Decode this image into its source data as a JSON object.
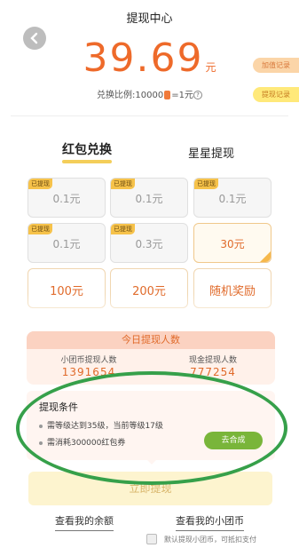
{
  "header": {
    "title": "提现中心"
  },
  "balance": {
    "amount": "39.69",
    "unit": "元"
  },
  "ratio": {
    "prefix": "兑换比例:10000",
    "suffix": "=1元",
    "help": "?"
  },
  "side_buttons": {
    "add_record": "加值记录",
    "withdraw_record": "提现记录"
  },
  "tabs": [
    {
      "label": "红包兑换"
    },
    {
      "label": "星星提现"
    }
  ],
  "cards": [
    {
      "badge": "已提现",
      "value": "0.1元"
    },
    {
      "badge": "已提现",
      "value": "0.1元"
    },
    {
      "badge": "已提现",
      "value": "0.1元"
    },
    {
      "badge": "已提现",
      "value": "0.1元"
    },
    {
      "badge": "已提现",
      "value": "0.3元"
    },
    {
      "badge": "",
      "value": "30元"
    },
    {
      "badge": "",
      "value": "100元"
    },
    {
      "badge": "",
      "value": "200元"
    },
    {
      "badge": "",
      "value": "随机奖励"
    }
  ],
  "stats": {
    "header": "今日提现人数",
    "left_label": "小团币提现人数",
    "left_value": "1391654",
    "right_label": "现金提现人数",
    "right_value": "777254"
  },
  "conditions": {
    "title": "提现条件",
    "rows": [
      "需等级达到35级，当前等级17级",
      "需消耗300000红包券"
    ],
    "go_button": "去合成"
  },
  "withdraw_button": "立即提现",
  "links": {
    "balance": "查看我的余额",
    "coins": "查看我的小团币"
  },
  "checkbox_label": "默认提现小团币，可抵扣支付",
  "colors": {
    "accent": "#ee6a2a",
    "green": "#79b53a",
    "highlight": "#36a04a"
  }
}
